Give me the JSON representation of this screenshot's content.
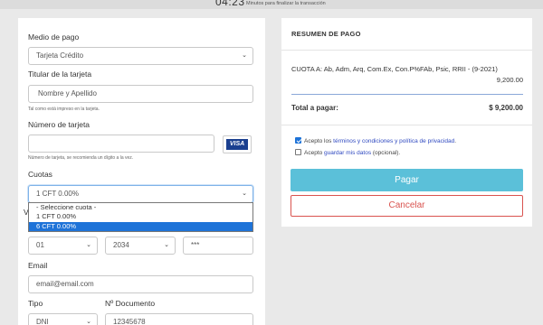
{
  "timer": {
    "value": "04:23",
    "note": "Minutos para finalizar la transacción"
  },
  "form": {
    "medio_pago": {
      "label": "Medio de pago",
      "value": "Tarjeta Crédito"
    },
    "titular": {
      "label": "Titular de la tarjeta",
      "placeholder": "Nombre y Apellido",
      "help": "Tal como está impreso en la tarjeta."
    },
    "numero": {
      "label": "Número de tarjeta",
      "value": "",
      "help": "Número de tarjeta, se recomienda un dígito a la vez.",
      "brand": "VISA"
    },
    "cuotas": {
      "label": "Cuotas",
      "value": "1 CFT 0.00%",
      "options": [
        "- Seleccione cuota -",
        "1 CFT 0.00%",
        "6 CFT 0.00%"
      ],
      "highlighted_option": "6 CFT 0.00%"
    },
    "vencimiento": {
      "label_partial": "V",
      "month": "01",
      "year": "2034",
      "cvv": "***"
    },
    "email": {
      "label": "Email",
      "placeholder": "email@email.com"
    },
    "tipo": {
      "label": "Tipo",
      "value": "DNI"
    },
    "documento": {
      "label": "Nº Documento",
      "placeholder": "12345678"
    }
  },
  "summary": {
    "title": "RESUMEN DE PAGO",
    "line_description": "CUOTA A: Ab, Adm, Arq, Com.Ex, Con.P%FAb, Psic, RRII - (9-2021)",
    "line_amount": "9,200.00",
    "total_label": "Total a pagar:",
    "total_amount": "$ 9,200.00",
    "terms": {
      "prefix": "Acepto los ",
      "link": "términos y condiciones y política de privacidad",
      "suffix": ".",
      "checked": true
    },
    "save": {
      "prefix": "Acepto ",
      "link": "guardar mis datos",
      "suffix": " (opcional).",
      "checked": false
    },
    "pay_label": "Pagar",
    "cancel_label": "Cancelar"
  },
  "colors": {
    "pay_button": "#5bc0d9",
    "cancel_border": "#d9534f",
    "link": "#2f49c0",
    "highlight": "#1e73d8"
  }
}
